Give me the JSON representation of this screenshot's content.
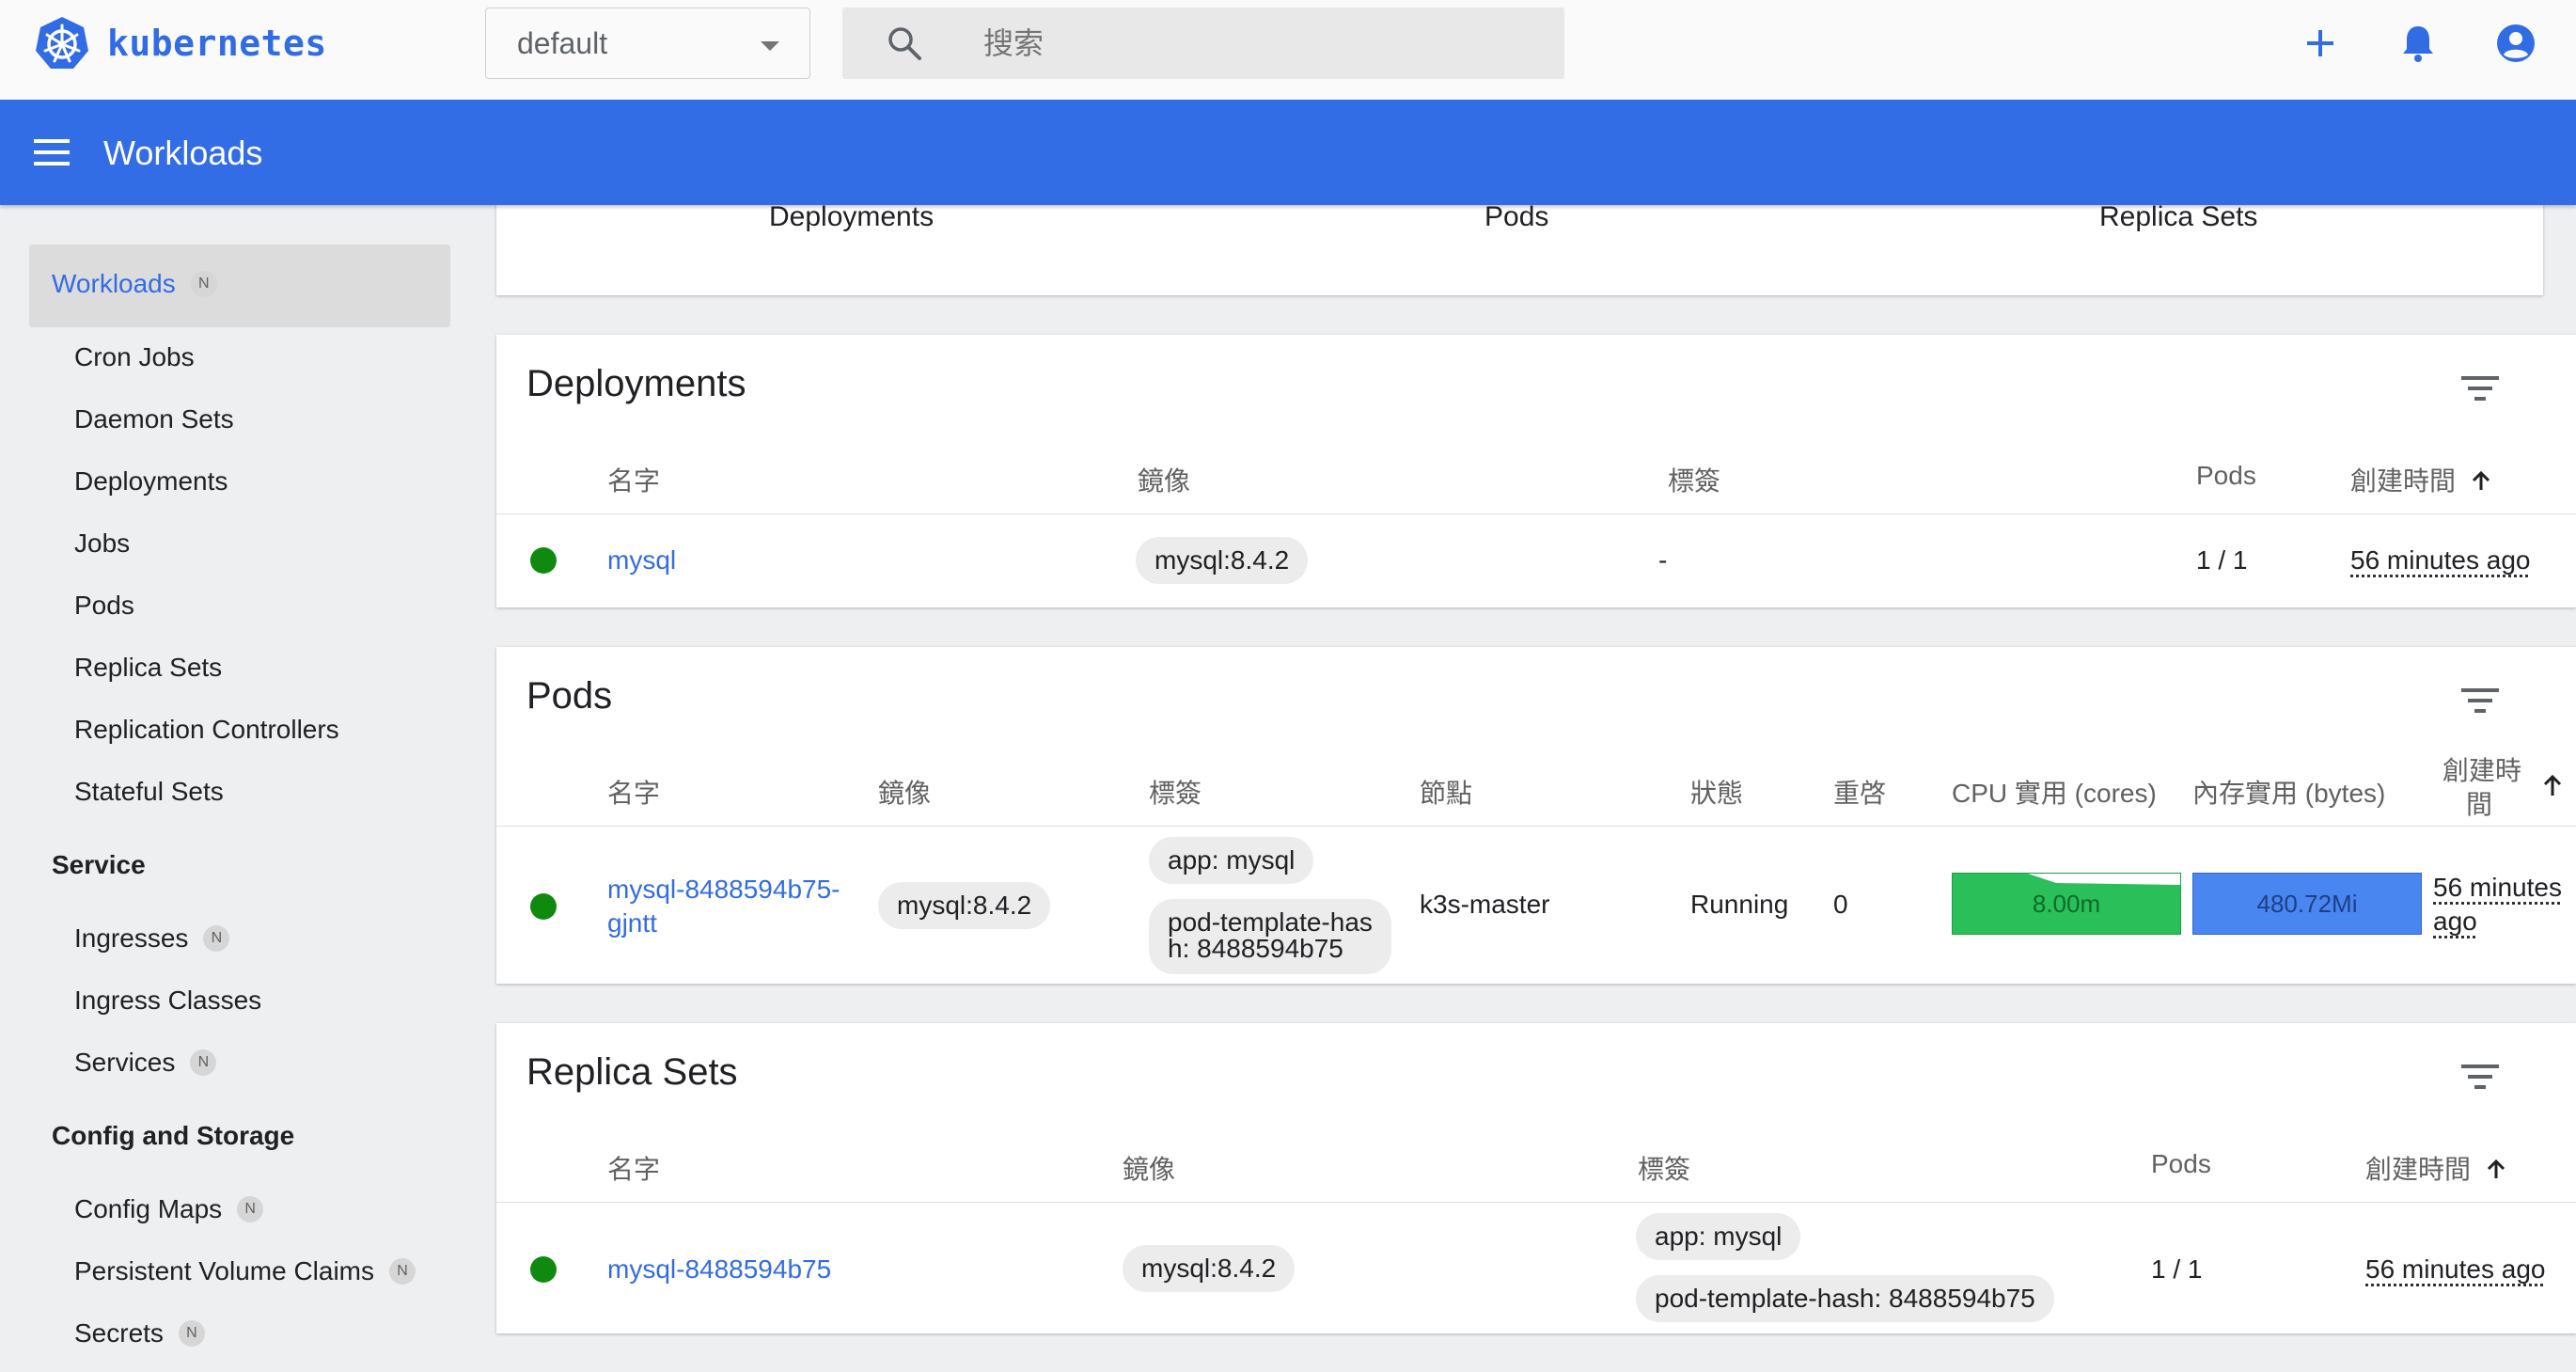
{
  "brand": {
    "name": "kubernetes",
    "color": "#326ce5"
  },
  "header": {
    "namespace": "default",
    "search_placeholder": "搜索",
    "icons": [
      "plus-icon",
      "bell-icon",
      "account-icon"
    ]
  },
  "toolbar": {
    "title": "Workloads"
  },
  "sidebar": {
    "workloads": {
      "label": "Workloads",
      "badge": "N"
    },
    "workload_items": [
      "Cron Jobs",
      "Daemon Sets",
      "Deployments",
      "Jobs",
      "Pods",
      "Replica Sets",
      "Replication Controllers",
      "Stateful Sets"
    ],
    "service": {
      "title": "Service",
      "ingresses": "Ingresses",
      "ingress_classes": "Ingress Classes",
      "services": "Services",
      "badge": "N"
    },
    "config": {
      "title": "Config and Storage",
      "config_maps": "Config Maps",
      "pvc": "Persistent Volume Claims",
      "secrets": "Secrets",
      "badge": "N"
    }
  },
  "summary_tabs": [
    "Deployments",
    "Pods",
    "Replica Sets"
  ],
  "deployments": {
    "title": "Deployments",
    "headers": {
      "name": "名字",
      "images": "鏡像",
      "labels": "標簽",
      "pods": "Pods",
      "created": "創建時間"
    },
    "rows": [
      {
        "name": "mysql",
        "image": "mysql:8.4.2",
        "labels": "-",
        "pods": "1 / 1",
        "created": "56 minutes ago"
      }
    ]
  },
  "pods": {
    "title": "Pods",
    "headers": {
      "name": "名字",
      "images": "鏡像",
      "labels": "標簽",
      "node": "節點",
      "status": "狀態",
      "restarts": "重啓",
      "cpu": "CPU 實用 (cores)",
      "memory": "內存實用 (bytes)",
      "created_1": "創建時",
      "created_2": "間"
    },
    "rows": [
      {
        "name_1": "mysql-8488594b75-",
        "name_2": "gjntt",
        "image": "mysql:8.4.2",
        "label_1": "app: mysql",
        "label_2a": "pod-template-has",
        "label_2b": "h: 8488594b75",
        "node": "k3s-master",
        "status": "Running",
        "restarts": "0",
        "cpu": "8.00m",
        "memory": "480.72Mi",
        "created_1": "56 minutes",
        "created_2": "ago"
      }
    ]
  },
  "replica_sets": {
    "title": "Replica Sets",
    "headers": {
      "name": "名字",
      "images": "鏡像",
      "labels": "標簽",
      "pods": "Pods",
      "created": "創建時間"
    },
    "rows": [
      {
        "name": "mysql-8488594b75",
        "image": "mysql:8.4.2",
        "label_1": "app: mysql",
        "label_2": "pod-template-hash: 8488594b75",
        "pods": "1 / 1",
        "created": "56 minutes ago"
      }
    ]
  },
  "colors": {
    "running": "#0f8a0f",
    "cpu_bar": "#2bbf5a",
    "memory_bar": "#4a86ef",
    "toolbar": "#326de6"
  }
}
